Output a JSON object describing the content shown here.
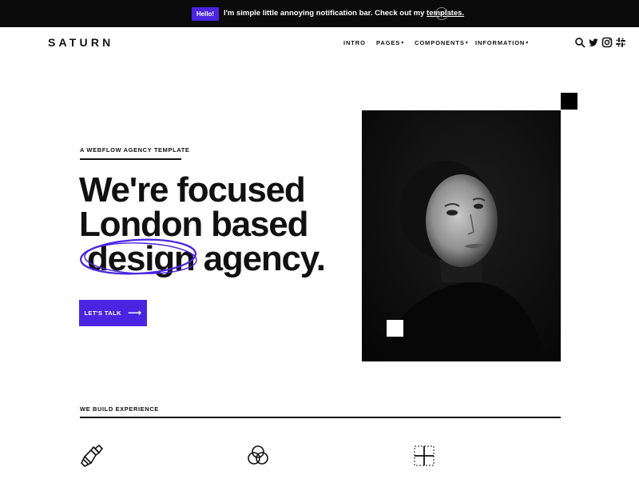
{
  "notification": {
    "badge": "Hello!",
    "text": "I'm simple little annoying notification bar. Check out my ",
    "link": "templates.",
    "close_glyph": "×"
  },
  "nav": {
    "logo": "SATURN",
    "items": [
      {
        "label": "INTRO",
        "has_caret": false
      },
      {
        "label": "PAGES",
        "has_caret": true
      },
      {
        "label": "COMPONENTS",
        "has_caret": true
      },
      {
        "label": "INFORMATION",
        "has_caret": true
      }
    ],
    "caret_glyph": "▾",
    "icons": [
      "search-icon",
      "twitter-icon",
      "instagram-icon",
      "slack-icon"
    ]
  },
  "hero": {
    "eyebrow": "A WEBFLOW AGENCY TEMPLATE",
    "line1": "We're focused",
    "line2": "London based",
    "line3_highlight": "design",
    "line3_rest": "agency.",
    "cta_label": "LET'S TALK",
    "cta_arrow": "⟶"
  },
  "section": {
    "title": "WE BUILD EXPERIENCE",
    "icons": [
      "paint-brush-icon",
      "color-circles-icon",
      "grid-layout-icon"
    ]
  },
  "colors": {
    "accent": "#4a25e1",
    "dark": "#0b0b0b",
    "text": "#111111"
  }
}
